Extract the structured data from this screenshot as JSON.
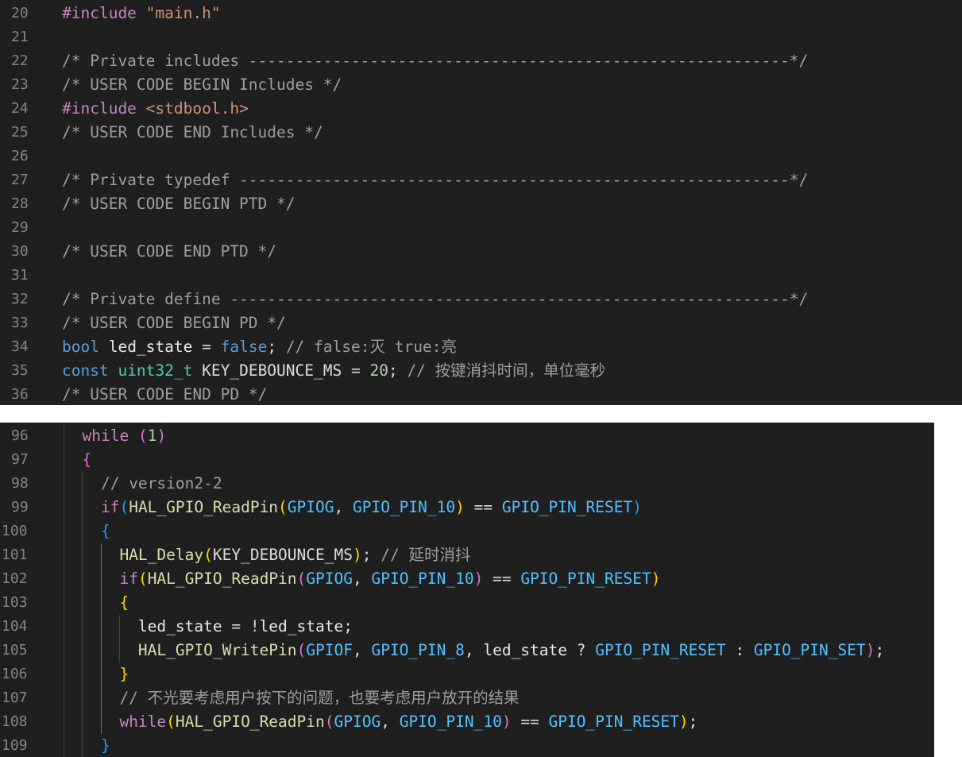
{
  "panels": [
    {
      "lines": [
        {
          "num": "20",
          "tokens": [
            [
              "pp",
              "#include "
            ],
            [
              "str",
              "\"main.h\""
            ]
          ]
        },
        {
          "num": "21",
          "tokens": []
        },
        {
          "num": "22",
          "tokens": [
            [
              "com",
              "/* Private includes ----------------------------------------------------------*/"
            ]
          ]
        },
        {
          "num": "23",
          "tokens": [
            [
              "com",
              "/* USER CODE BEGIN Includes */"
            ]
          ]
        },
        {
          "num": "24",
          "tokens": [
            [
              "pp",
              "#include "
            ],
            [
              "inc",
              "<stdbool.h>"
            ]
          ]
        },
        {
          "num": "25",
          "tokens": [
            [
              "com",
              "/* USER CODE END Includes */"
            ]
          ]
        },
        {
          "num": "26",
          "tokens": []
        },
        {
          "num": "27",
          "tokens": [
            [
              "com",
              "/* Private typedef -----------------------------------------------------------*/"
            ]
          ]
        },
        {
          "num": "28",
          "tokens": [
            [
              "com",
              "/* USER CODE BEGIN PTD */"
            ]
          ]
        },
        {
          "num": "29",
          "tokens": []
        },
        {
          "num": "30",
          "tokens": [
            [
              "com",
              "/* USER CODE END PTD */"
            ]
          ]
        },
        {
          "num": "31",
          "tokens": []
        },
        {
          "num": "32",
          "tokens": [
            [
              "com",
              "/* Private define ------------------------------------------------------------*/"
            ]
          ]
        },
        {
          "num": "33",
          "tokens": [
            [
              "com",
              "/* USER CODE BEGIN PD */"
            ]
          ]
        },
        {
          "num": "34",
          "tokens": [
            [
              "kw",
              "bool"
            ],
            [
              "op",
              " "
            ],
            [
              "var",
              "led_state"
            ],
            [
              "op",
              " = "
            ],
            [
              "kw",
              "false"
            ],
            [
              "op",
              "; "
            ],
            [
              "com",
              "// false:灭 true:亮"
            ]
          ]
        },
        {
          "num": "35",
          "tokens": [
            [
              "kw",
              "const"
            ],
            [
              "op",
              " "
            ],
            [
              "typ",
              "uint32_t"
            ],
            [
              "op",
              " "
            ],
            [
              "id",
              "KEY_DEBOUNCE_MS"
            ],
            [
              "op",
              " = "
            ],
            [
              "num",
              "20"
            ],
            [
              "op",
              "; "
            ],
            [
              "com",
              "// 按键消抖时间，单位毫秒"
            ]
          ]
        },
        {
          "num": "36",
          "tokens": [
            [
              "com",
              "/* USER CODE END PD */"
            ]
          ]
        }
      ]
    },
    {
      "lines": [
        {
          "num": "96",
          "tokens": [
            [
              "op",
              "  "
            ],
            [
              "ctl",
              "while"
            ],
            [
              "op",
              " "
            ],
            [
              "br2",
              "("
            ],
            [
              "num",
              "1"
            ],
            [
              "br2",
              ")"
            ]
          ]
        },
        {
          "num": "97",
          "tokens": [
            [
              "op",
              "  "
            ],
            [
              "br2",
              "{"
            ]
          ]
        },
        {
          "num": "98",
          "tokens": [
            [
              "op",
              "    "
            ],
            [
              "com",
              "// version2-2"
            ]
          ]
        },
        {
          "num": "99",
          "tokens": [
            [
              "op",
              "    "
            ],
            [
              "ctl",
              "if"
            ],
            [
              "br3",
              "("
            ],
            [
              "fn",
              "HAL_GPIO_ReadPin"
            ],
            [
              "br1",
              "("
            ],
            [
              "mac",
              "GPIOG"
            ],
            [
              "op",
              ", "
            ],
            [
              "mac",
              "GPIO_PIN_10"
            ],
            [
              "br1",
              ")"
            ],
            [
              "op",
              " == "
            ],
            [
              "mac",
              "GPIO_PIN_RESET"
            ],
            [
              "br3",
              ")"
            ]
          ]
        },
        {
          "num": "100",
          "tokens": [
            [
              "op",
              "    "
            ],
            [
              "br3",
              "{"
            ]
          ]
        },
        {
          "num": "101",
          "tokens": [
            [
              "op",
              "      "
            ],
            [
              "fn",
              "HAL_Delay"
            ],
            [
              "br1",
              "("
            ],
            [
              "id",
              "KEY_DEBOUNCE_MS"
            ],
            [
              "br1",
              ")"
            ],
            [
              "op",
              "; "
            ],
            [
              "com",
              "// 延时消抖"
            ]
          ]
        },
        {
          "num": "102",
          "tokens": [
            [
              "op",
              "      "
            ],
            [
              "ctl",
              "if"
            ],
            [
              "br1",
              "("
            ],
            [
              "fn",
              "HAL_GPIO_ReadPin"
            ],
            [
              "br2",
              "("
            ],
            [
              "mac",
              "GPIOG"
            ],
            [
              "op",
              ", "
            ],
            [
              "mac",
              "GPIO_PIN_10"
            ],
            [
              "br2",
              ")"
            ],
            [
              "op",
              " == "
            ],
            [
              "mac",
              "GPIO_PIN_RESET"
            ],
            [
              "br1",
              ")"
            ]
          ]
        },
        {
          "num": "103",
          "tokens": [
            [
              "op",
              "      "
            ],
            [
              "br1",
              "{"
            ]
          ]
        },
        {
          "num": "104",
          "tokens": [
            [
              "op",
              "        "
            ],
            [
              "var",
              "led_state"
            ],
            [
              "op",
              " = !"
            ],
            [
              "var",
              "led_state"
            ],
            [
              "op",
              ";"
            ]
          ]
        },
        {
          "num": "105",
          "tokens": [
            [
              "op",
              "        "
            ],
            [
              "fn",
              "HAL_GPIO_WritePin"
            ],
            [
              "br2",
              "("
            ],
            [
              "mac",
              "GPIOF"
            ],
            [
              "op",
              ", "
            ],
            [
              "mac",
              "GPIO_PIN_8"
            ],
            [
              "op",
              ", "
            ],
            [
              "var",
              "led_state"
            ],
            [
              "op",
              " ? "
            ],
            [
              "mac",
              "GPIO_PIN_RESET"
            ],
            [
              "op",
              " : "
            ],
            [
              "mac",
              "GPIO_PIN_SET"
            ],
            [
              "br2",
              ")"
            ],
            [
              "op",
              ";"
            ]
          ]
        },
        {
          "num": "106",
          "tokens": [
            [
              "op",
              "      "
            ],
            [
              "br1",
              "}"
            ]
          ]
        },
        {
          "num": "107",
          "tokens": [
            [
              "op",
              "      "
            ],
            [
              "com",
              "// 不光要考虑用户按下的问题，也要考虑用户放开的结果"
            ]
          ]
        },
        {
          "num": "108",
          "tokens": [
            [
              "op",
              "      "
            ],
            [
              "ctl",
              "while"
            ],
            [
              "br1",
              "("
            ],
            [
              "fn",
              "HAL_GPIO_ReadPin"
            ],
            [
              "br2",
              "("
            ],
            [
              "mac",
              "GPIOG"
            ],
            [
              "op",
              ", "
            ],
            [
              "mac",
              "GPIO_PIN_10"
            ],
            [
              "br2",
              ")"
            ],
            [
              "op",
              " == "
            ],
            [
              "mac",
              "GPIO_PIN_RESET"
            ],
            [
              "br1",
              ")"
            ],
            [
              "op",
              ";"
            ]
          ]
        },
        {
          "num": "109",
          "tokens": [
            [
              "op",
              "    "
            ],
            [
              "br3",
              "}"
            ]
          ]
        }
      ]
    }
  ]
}
